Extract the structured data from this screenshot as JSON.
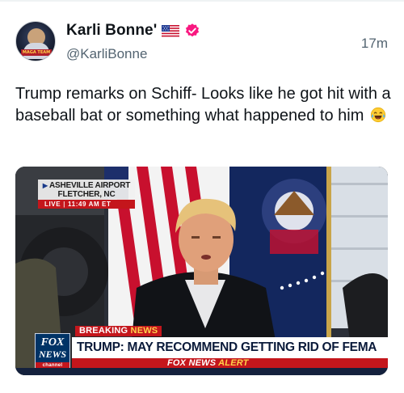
{
  "author": {
    "display_name": "Karli Bonne'",
    "handle": "@KarliBonne",
    "avatar_badge_text": "MAGA TEAM",
    "flag_icon": "us-flag-icon",
    "verified_icon": "verified-badge-icon",
    "verified_color": "#f91880"
  },
  "tweet": {
    "timestamp": "17m",
    "text": "Trump remarks on Schiff- Looks like he got hit with a baseball bat or something what happened to him",
    "emoji_icon": "face-with-tears-of-joy-icon"
  },
  "media": {
    "location_line1": "ASHEVILLE AIRPORT",
    "location_line2": "FLETCHER, NC",
    "live_label": "LIVE",
    "live_time": "11:49 AM ET",
    "network_logo_line1": "FOX",
    "network_logo_line2": "NEWS",
    "network_logo_line3": "channel",
    "breaking_prefix": "BREAKING",
    "breaking_suffix": "NEWS",
    "headline": "TRUMP: MAY RECOMMEND GETTING RID OF FEMA",
    "alert_prefix": "FOX NEWS",
    "alert_suffix": "ALERT",
    "colors": {
      "fox_red": "#c4161c",
      "fox_navy": "#003366",
      "alert_yellow": "#ffd24a"
    }
  }
}
